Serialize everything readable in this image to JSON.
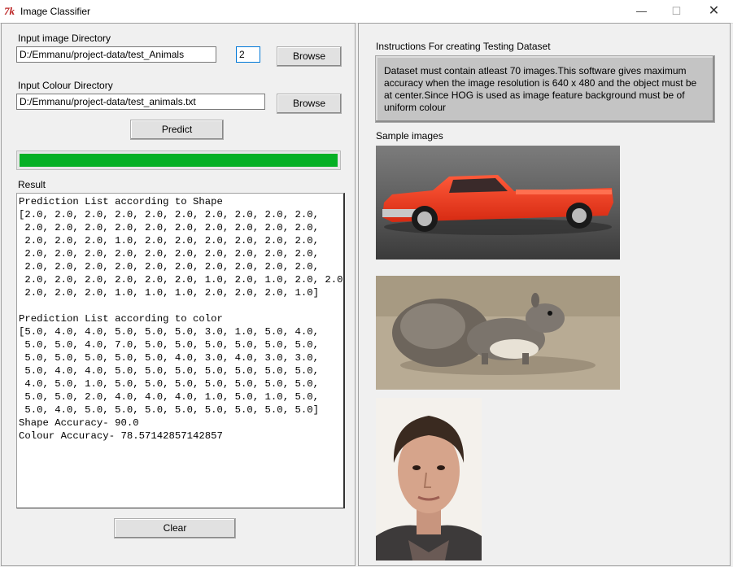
{
  "window": {
    "title": "Image Classifier",
    "icon": "tk-feather-icon",
    "minimize": "—",
    "maximize": "☐",
    "close": "✕"
  },
  "left": {
    "input_dir_label": "Input image Directory",
    "input_dir_value": "D:/Emmanu/project-data/test_Animals",
    "count_value": "2",
    "browse1_label": "Browse",
    "colour_dir_label": "Input Colour Directory",
    "colour_dir_value": "D:/Emmanu/project-data/test_animals.txt",
    "browse2_label": "Browse",
    "predict_label": "Predict",
    "progress_fraction": 1.0,
    "progress_color": "#06b025",
    "result_label": "Result",
    "result_lines": [
      "Prediction List according to Shape",
      "[2.0, 2.0, 2.0, 2.0, 2.0, 2.0, 2.0, 2.0, 2.0, 2.0,",
      " 2.0, 2.0, 2.0, 2.0, 2.0, 2.0, 2.0, 2.0, 2.0, 2.0,",
      " 2.0, 2.0, 2.0, 1.0, 2.0, 2.0, 2.0, 2.0, 2.0, 2.0,",
      " 2.0, 2.0, 2.0, 2.0, 2.0, 2.0, 2.0, 2.0, 2.0, 2.0,",
      " 2.0, 2.0, 2.0, 2.0, 2.0, 2.0, 2.0, 2.0, 2.0, 2.0,",
      " 2.0, 2.0, 2.0, 2.0, 2.0, 2.0, 1.0, 2.0, 1.0, 2.0, 2.0,",
      " 2.0, 2.0, 2.0, 1.0, 1.0, 1.0, 2.0, 2.0, 2.0, 1.0]",
      "",
      "Prediction List according to color",
      "[5.0, 4.0, 4.0, 5.0, 5.0, 5.0, 3.0, 1.0, 5.0, 4.0,",
      " 5.0, 5.0, 4.0, 7.0, 5.0, 5.0, 5.0, 5.0, 5.0, 5.0,",
      " 5.0, 5.0, 5.0, 5.0, 5.0, 4.0, 3.0, 4.0, 3.0, 3.0,",
      " 5.0, 4.0, 4.0, 5.0, 5.0, 5.0, 5.0, 5.0, 5.0, 5.0,",
      " 4.0, 5.0, 1.0, 5.0, 5.0, 5.0, 5.0, 5.0, 5.0, 5.0,",
      " 5.0, 5.0, 2.0, 4.0, 4.0, 4.0, 1.0, 5.0, 1.0, 5.0,",
      " 5.0, 4.0, 5.0, 5.0, 5.0, 5.0, 5.0, 5.0, 5.0, 5.0]",
      "Shape Accuracy- 90.0",
      "Colour Accuracy- 78.57142857142857"
    ],
    "clear_label": "Clear"
  },
  "right": {
    "instructions_label": "Instructions For creating Testing Dataset",
    "instructions_text": "Dataset must contain atleast 70 images.This software gives maximum accuracy when the image resolution is 640 x 480 and the object must be at center.Since HOG is used as image feature background must be of uniform colour",
    "sample_label": "Sample images",
    "samples": [
      "red-pickup-truck-image",
      "squirrel-image",
      "man-portrait-image"
    ]
  }
}
